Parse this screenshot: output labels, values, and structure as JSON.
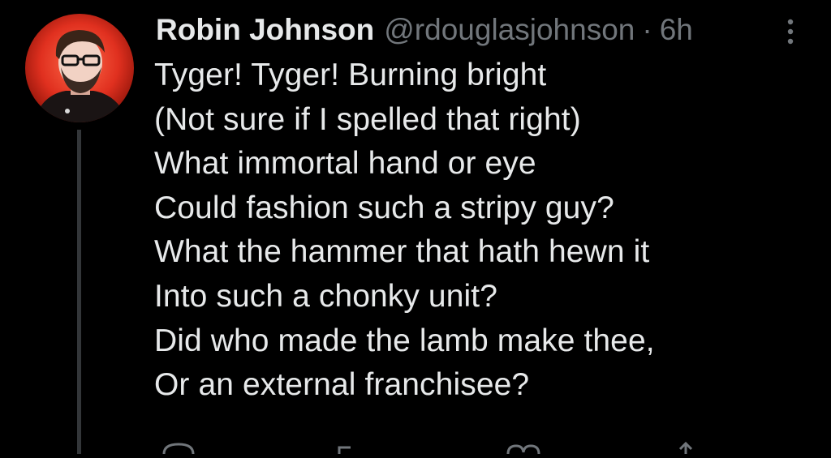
{
  "user": {
    "display_name": "Robin Johnson",
    "handle": "@rdouglasjohnson",
    "separator": "·",
    "time": "6h"
  },
  "tweet": {
    "lines": [
      "Tyger! Tyger! Burning bright",
      "(Not sure if I spelled that right)",
      "What immortal hand or eye",
      "Could fashion such a stripy guy?",
      "What the hammer that hath hewn it",
      "Into such a chonky unit?",
      "Did who made the lamb make thee,",
      "Or an external franchisee?"
    ]
  },
  "icons": {
    "more": "more-icon",
    "avatar": "avatar-photo",
    "reply": "reply-icon",
    "retweet": "retweet-icon",
    "like": "like-icon",
    "share": "share-icon"
  },
  "colors": {
    "background": "#000000",
    "text_primary": "#e7e9ea",
    "text_secondary": "#71767b",
    "thread_line": "#333639"
  }
}
